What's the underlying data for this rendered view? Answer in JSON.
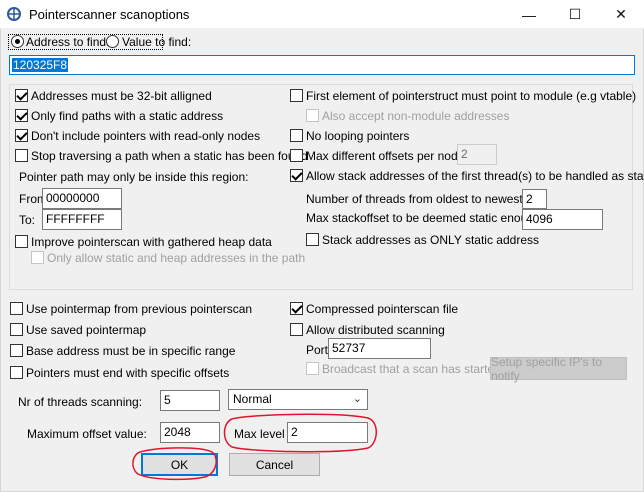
{
  "window": {
    "title": "Pointerscanner scanoptions",
    "minimize_glyph": "—",
    "maximize_glyph": "☐",
    "close_glyph": "✕"
  },
  "find": {
    "address_label": "Address to find:",
    "value_label": "Value to find:",
    "address_value": "120325F8",
    "mode": "address"
  },
  "left_options": {
    "aligned_label": "Addresses must be 32-bit alligned",
    "static_paths_label": "Only find paths with a static address",
    "readonly_label": "Don't include pointers with read-only nodes",
    "stop_traversing_label": "Stop traversing a path when a static has been found",
    "region_label": "Pointer path may only be inside this region:",
    "from_label": "From",
    "from_value": "00000000",
    "to_label": "To:",
    "to_value": "FFFFFFFF",
    "heap_label": "Improve pointerscan with gathered heap data",
    "heap_only_label": "Only allow static and heap addresses in the path"
  },
  "right_options": {
    "first_element_label": "First element of pointerstruct must point to module (e.g vtable)",
    "non_module_label": "Also accept non-module addresses",
    "no_looping_label": "No looping pointers",
    "max_offsets_label": "Max different offsets per node:",
    "max_offsets_value": "2",
    "stack_label": "Allow stack addresses of the first thread(s) to be handled as static",
    "threads_label": "Number of threads from oldest to newest:",
    "threads_value": "2",
    "stackoffset_label": "Max stackoffset to be deemed static enough:",
    "stackoffset_value": "4096",
    "stack_only_label": "Stack addresses as ONLY static address"
  },
  "lower_options": {
    "pointermap_prev_label": "Use pointermap from previous pointerscan",
    "saved_pointermap_label": "Use saved pointermap",
    "base_address_label": "Base address must be in specific range",
    "end_offsets_label": "Pointers must end with specific offsets",
    "compressed_label": "Compressed pointerscan file",
    "distributed_label": "Allow distributed scanning",
    "port_label": "Port:",
    "port_value": "52737",
    "broadcast_label": "Broadcast that a scan has started",
    "setup_ips_label": "Setup specific IP's to notify"
  },
  "scan_settings": {
    "threads_label": "Nr of threads scanning:",
    "threads_value": "5",
    "priority_value": "Normal",
    "max_offset_label": "Maximum offset value:",
    "max_offset_value": "2048",
    "max_level_label": "Max level",
    "max_level_value": "2"
  },
  "buttons": {
    "ok_label": "OK",
    "cancel_label": "Cancel"
  },
  "colors": {
    "accent": "#0078d7",
    "annotation": "#e0152b"
  }
}
